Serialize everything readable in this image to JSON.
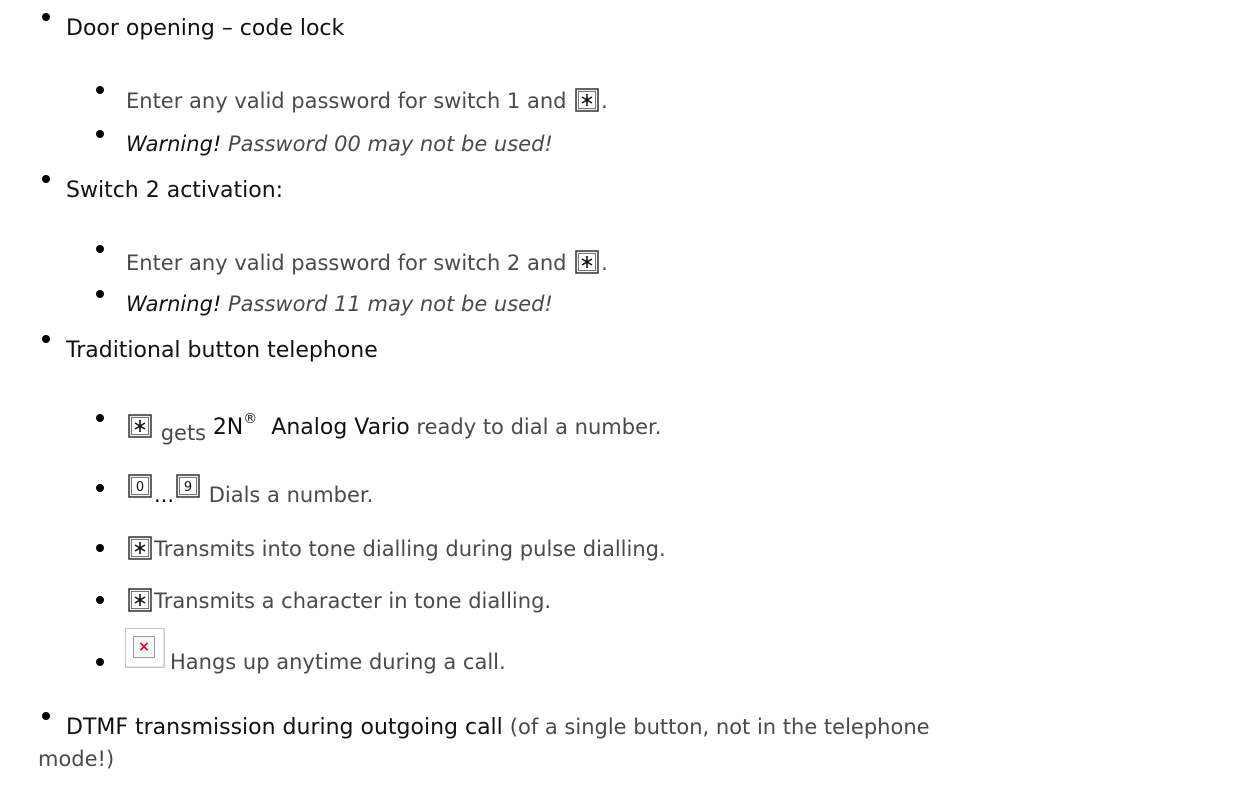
{
  "items": {
    "door": {
      "title": "Door opening – code lock",
      "sub1_text": "Enter any valid password for switch 1 and",
      "sub1_end": ".",
      "sub2_warn": "Warning!",
      "sub2_text": "Password 00 may not be used!"
    },
    "switch2": {
      "title": "Switch 2 activation:",
      "sub1_text": "Enter any valid password for switch 2 and",
      "sub1_end": ".",
      "sub2_warn": "Warning!",
      "sub2_text": "Password 11 may not be used!"
    },
    "telephone": {
      "title": "Traditional button telephone",
      "sub1_pre": "gets",
      "brand": "2N",
      "reg": "®",
      "product": "Analog Vario",
      "sub1_post": "ready to dial a number.",
      "key_0": "0",
      "dots": "...",
      "key_9": "9",
      "sub2_text": "Dials a number.",
      "sub3_text": "Transmits into tone dialling during pulse dialling.",
      "sub4_text": "Transmits a character in tone dialling.",
      "broken_mark": "×",
      "sub5_text": "Hangs up anytime during a call."
    },
    "dtmf": {
      "title": "DTMF transmission during outgoing call",
      "note_line1": "(of a single button, not in the telephone",
      "note_line2": "mode!)"
    }
  },
  "icons": {
    "key": "star-key-icon",
    "broken": "broken-image-icon"
  }
}
